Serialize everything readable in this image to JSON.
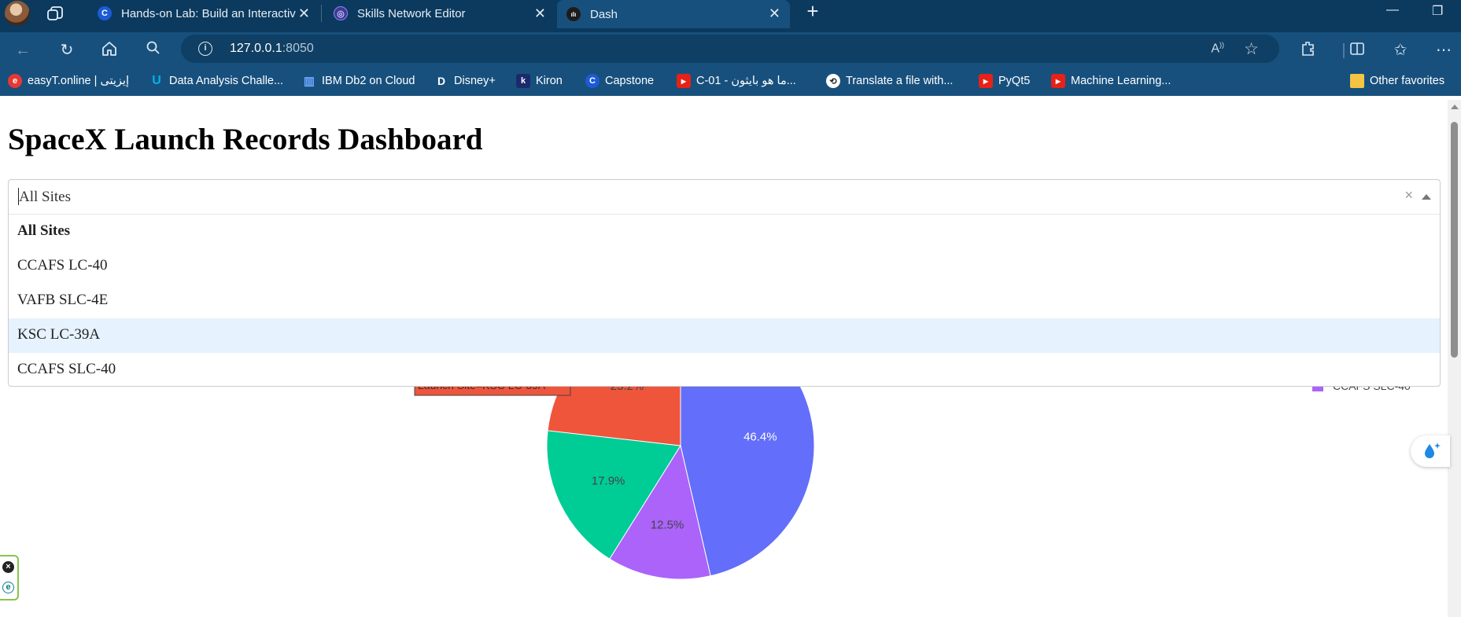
{
  "browser": {
    "tabs": [
      {
        "title": "Hands-on Lab: Build an Interactiv",
        "favicon": "coursera-icon",
        "color": "#1d5bd6"
      },
      {
        "title": "Skills Network Editor",
        "favicon": "skills-network-icon",
        "color": "#6c4fd6"
      },
      {
        "title": "Dash",
        "favicon": "dash-icon",
        "color": "#1c1c1c"
      }
    ],
    "new_tab": "+",
    "close": "✕",
    "window_controls": {
      "minimize": "—",
      "restore": "❐"
    },
    "url_host": "127.0.0.1",
    "url_port": ":8050",
    "favorites": [
      {
        "label": "easyT.online | إيزيتى",
        "icon": "easyt-icon",
        "color": "#e53935",
        "glyph": "e"
      },
      {
        "label": "Data Analysis Challe...",
        "icon": "udacity-icon",
        "color": "#02b3e4",
        "glyph": "U"
      },
      {
        "label": "IBM Db2 on Cloud",
        "icon": "ibm-db2-icon",
        "color": "#1f70c1",
        "glyph": "▥"
      },
      {
        "label": "Disney+",
        "icon": "disney-icon",
        "color": "#113ccf",
        "glyph": "D"
      },
      {
        "label": "Kiron",
        "icon": "kiron-icon",
        "color": "#1b2a6b",
        "glyph": "k"
      },
      {
        "label": "Capstone",
        "icon": "coursera-icon",
        "color": "#1d5bd6",
        "glyph": "C"
      },
      {
        "label": "C-01 - ما هو بايثون...",
        "icon": "youtube-icon",
        "color": "#e62117",
        "glyph": "▶"
      },
      {
        "label": "Translate a file with...",
        "icon": "translate-icon",
        "color": "#222222",
        "glyph": "⟲"
      },
      {
        "label": "PyQt5",
        "icon": "youtube-icon",
        "color": "#e62117",
        "glyph": "▶"
      },
      {
        "label": "Machine Learning...",
        "icon": "youtube-icon",
        "color": "#e62117",
        "glyph": "▶"
      }
    ],
    "other_favorites": "Other favorites"
  },
  "page": {
    "title": "SpaceX Launch Records Dashboard",
    "dropdown": {
      "value": "All Sites",
      "clear": "×",
      "options": [
        {
          "label": "All Sites",
          "selected": true,
          "hover": false
        },
        {
          "label": "CCAFS LC-40",
          "selected": false,
          "hover": false
        },
        {
          "label": "VAFB SLC-4E",
          "selected": false,
          "hover": false
        },
        {
          "label": "KSC LC-39A",
          "selected": false,
          "hover": true
        },
        {
          "label": "CCAFS SLC-40",
          "selected": false,
          "hover": false
        }
      ]
    }
  },
  "chart_data": {
    "type": "pie",
    "slices": [
      {
        "label": "46.4%",
        "value": 46.4,
        "color": "#636efa"
      },
      {
        "label": "12.5%",
        "value": 12.5,
        "color": "#ab63fa"
      },
      {
        "label": "17.9%",
        "value": 17.9,
        "color": "#00cc96"
      },
      {
        "label": "23.2%",
        "value": 23.2,
        "color": "#ef553b"
      }
    ],
    "hover_label": "Launch Site=KSC LC-39A",
    "legend_visible_label": "CCAFS SLC-40"
  }
}
